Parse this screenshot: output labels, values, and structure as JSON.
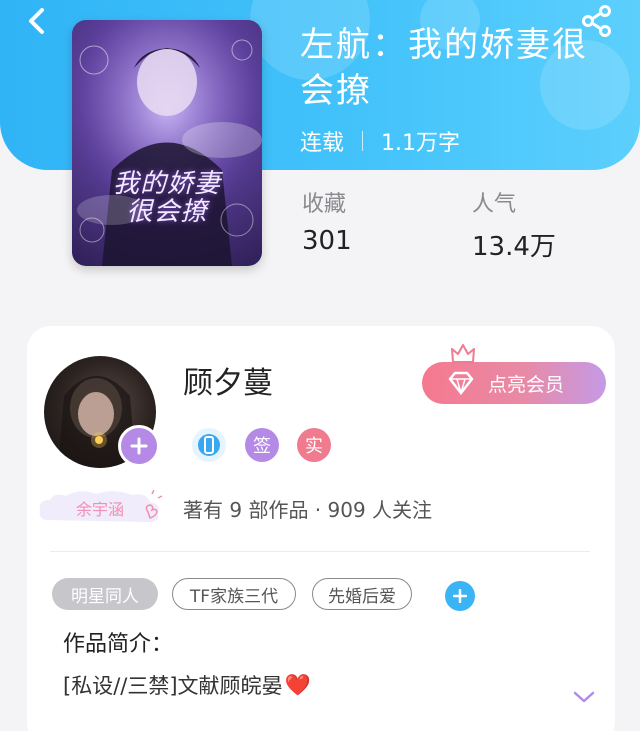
{
  "book": {
    "title": "左航：我的娇妻很会撩",
    "status": "连载",
    "word_count": "1.1万字",
    "cover_text": "我的娇妻很会撩"
  },
  "stats": {
    "favorites_label": "收藏",
    "favorites_value": "301",
    "popularity_label": "人气",
    "popularity_value": "13.4万"
  },
  "author": {
    "name": "顾夕蔓",
    "pen_badge": "余宇涵",
    "works_text": "著有 9 部作品 · 909 人关注",
    "vip_label": "点亮会员",
    "badges": [
      {
        "icon": "phone-badge-icon",
        "text": "",
        "color": "#3aa8f0"
      },
      {
        "icon": "signed-badge-icon",
        "text": "签",
        "color": "#b58ae6"
      },
      {
        "icon": "verified-badge-icon",
        "text": "实",
        "color": "#f07a8e"
      }
    ]
  },
  "tags": [
    "明星同人",
    "TF家族三代",
    "先婚后爱"
  ],
  "intro": {
    "title": "作品简介：",
    "text": "[私设//三禁]文献顾皖晏",
    "emoji": "❤️"
  },
  "colors": {
    "header": "#3ab8f8",
    "accent_blue": "#3ab4f4",
    "vip_pink": "#f5798f",
    "purple": "#b58ae6"
  }
}
